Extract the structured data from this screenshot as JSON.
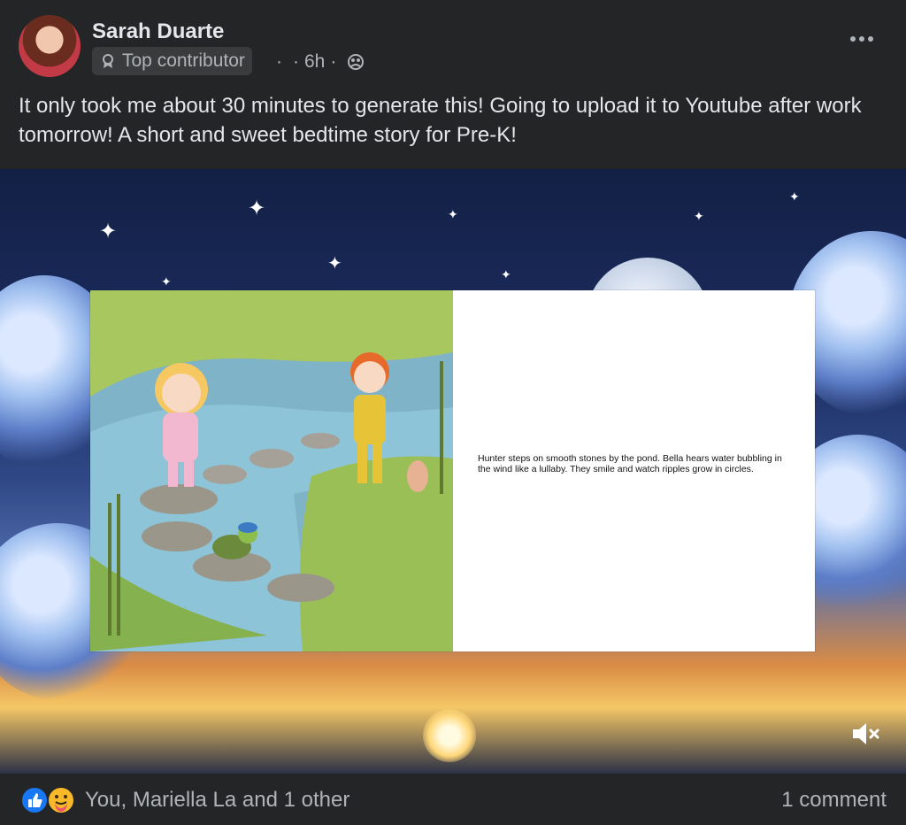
{
  "post": {
    "author": "Sarah Duarte",
    "badge": "Top contributor",
    "time": "6h",
    "text": "It only took me about 30 minutes to generate this! Going to upload it to Youtube after work tomorrow! A short and sweet bedtime story for Pre-K!",
    "slide_text": "Hunter steps on smooth stones by the pond. Bella hears water bubbling in the wind like a lullaby. They smile and watch ripples grow in circles."
  },
  "footer": {
    "reactions_text": "You, Mariella La and 1 other",
    "comments": "1 comment"
  },
  "icons": {
    "badge": "contributor-badge-icon",
    "audience": "friends-globe-icon",
    "more": "more-options-icon",
    "mute": "volume-muted-icon",
    "like": "like-reaction-icon",
    "care": "care-reaction-icon"
  },
  "colors": {
    "background": "#242526",
    "text_primary": "#e4e6eb",
    "text_secondary": "#b0b3b8",
    "like_blue": "#1877f2"
  }
}
